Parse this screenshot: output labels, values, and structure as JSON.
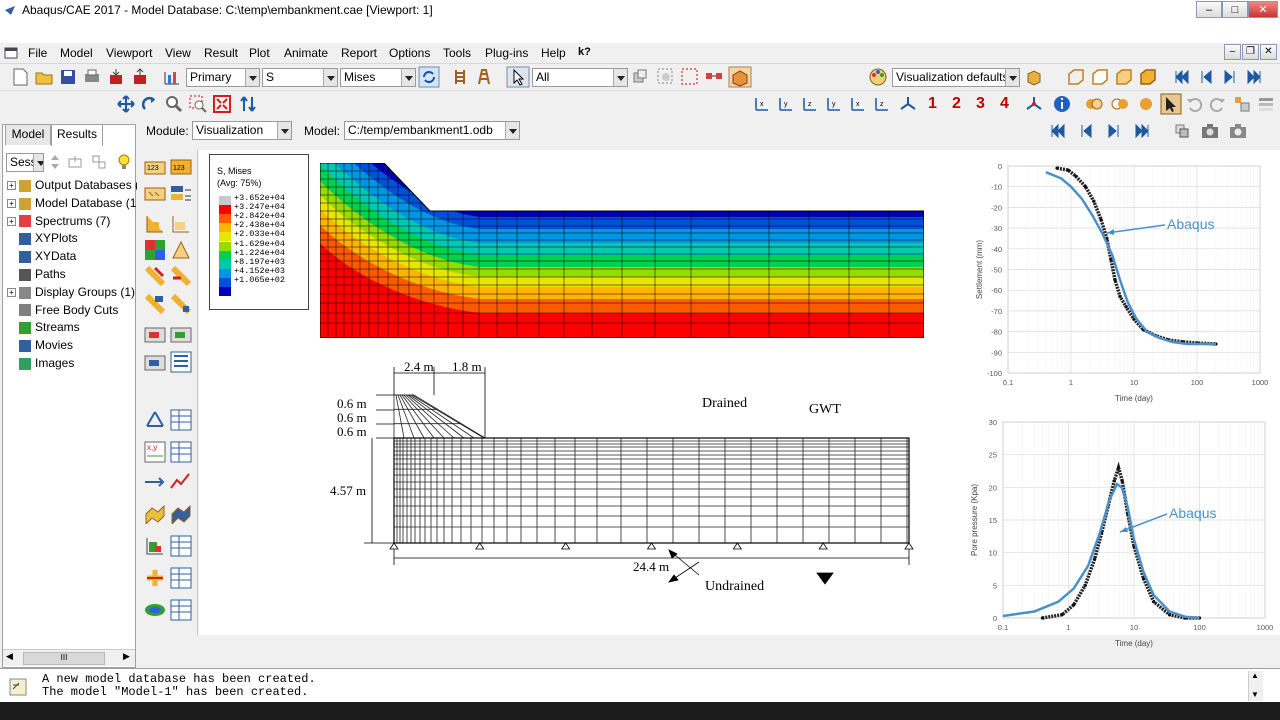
{
  "window": {
    "title": "Abaqus/CAE 2017 - Model Database: C:\\temp\\embankment.cae [Viewport: 1]",
    "min": "–",
    "max": "□",
    "close": "✕",
    "sub_min": "–",
    "sub_restore": "❐",
    "sub_close": "✕"
  },
  "menu": {
    "items": [
      "File",
      "Model",
      "Viewport",
      "View",
      "Result",
      "Plot",
      "Animate",
      "Report",
      "Options",
      "Tools",
      "Plug-ins",
      "Help",
      "k?"
    ]
  },
  "toolbar1": {
    "primary": "Primary",
    "variable": "S",
    "invariant": "Mises",
    "selection": "All",
    "vis_defaults": "Visualization defaults"
  },
  "toolbar2": {
    "numbers": [
      "1",
      "2",
      "3",
      "4"
    ]
  },
  "context": {
    "module_label": "Module:",
    "module_value": "Visualization",
    "model_label": "Model:",
    "model_value": "C:/temp/embankment1.odb"
  },
  "tree": {
    "tabs": [
      "Model",
      "Results"
    ],
    "session_value": "Sessi",
    "items": [
      {
        "label": "Output Databases (",
        "expand": "+"
      },
      {
        "label": "Model Database (1",
        "expand": "+"
      },
      {
        "label": "Spectrums (7)",
        "expand": "+"
      },
      {
        "label": "XYPlots",
        "expand": ""
      },
      {
        "label": "XYData",
        "expand": ""
      },
      {
        "label": "Paths",
        "expand": ""
      },
      {
        "label": "Display Groups (1)",
        "expand": "+"
      },
      {
        "label": "Free Body Cuts",
        "expand": ""
      },
      {
        "label": "Streams",
        "expand": ""
      },
      {
        "label": "Movies",
        "expand": ""
      },
      {
        "label": "Images",
        "expand": ""
      }
    ],
    "hscroll_mid": "III"
  },
  "legend": {
    "title1": "S, Mises",
    "title2": "(Avg: 75%)",
    "values": [
      "+3.652e+04",
      "+3.247e+04",
      "+2.842e+04",
      "+2.438e+04",
      "+2.033e+04",
      "+1.629e+04",
      "+1.224e+04",
      "+8.197e+03",
      "+4.152e+03",
      "+1.065e+02"
    ],
    "colors": [
      "#c8c8c8",
      "#ff0000",
      "#ff5a00",
      "#ffb400",
      "#e6e600",
      "#96dc00",
      "#00d250",
      "#00c8b4",
      "#0096e6",
      "#0050dc",
      "#0000b4"
    ]
  },
  "diagram": {
    "dim_24": "2.4 m",
    "dim_18": "1.8 m",
    "dim_06a": "0.6 m",
    "dim_06b": "0.6 m",
    "dim_06c": "0.6 m",
    "dim_457": "4.57 m",
    "dim_244": "24.4 m",
    "drained": "Drained",
    "gwt": "GWT",
    "undrained": "Undrained"
  },
  "chart_data": [
    {
      "type": "line",
      "ylabel": "Settlement (mm)",
      "xlabel": "Time (day)",
      "xscale": "log",
      "xlim": [
        0.1,
        1000
      ],
      "ylim": [
        -100,
        0
      ],
      "xticks": [
        "0.1",
        "1",
        "10",
        "100",
        "1000"
      ],
      "yticks": [
        "0",
        "-10",
        "-20",
        "-30",
        "-40",
        "-50",
        "-60",
        "-70",
        "-80",
        "-90",
        "-100"
      ],
      "annotation": "Abaqus",
      "color": "#4a90c8",
      "series": [
        {
          "values": [
            [
              0.4,
              -3
            ],
            [
              0.7,
              -6
            ],
            [
              1,
              -10
            ],
            [
              1.5,
              -16
            ],
            [
              2.2,
              -24
            ],
            [
              3.2,
              -33
            ],
            [
              4.5,
              -43
            ],
            [
              6,
              -55
            ],
            [
              8,
              -66
            ],
            [
              11,
              -74
            ],
            [
              16,
              -80
            ],
            [
              25,
              -83
            ],
            [
              40,
              -85
            ],
            [
              70,
              -86
            ],
            [
              120,
              -86
            ],
            [
              200,
              -86
            ]
          ]
        },
        {
          "values": [
            [
              0.6,
              -1
            ],
            [
              0.9,
              -2
            ],
            [
              1.2,
              -5
            ],
            [
              1.7,
              -10
            ],
            [
              2.3,
              -17
            ],
            [
              3,
              -26
            ],
            [
              3.7,
              -35
            ],
            [
              4.3,
              -45
            ],
            [
              5,
              -55
            ],
            [
              6,
              -63
            ],
            [
              7.5,
              -68
            ],
            [
              10,
              -74
            ],
            [
              14,
              -79
            ],
            [
              22,
              -82
            ],
            [
              35,
              -84
            ],
            [
              60,
              -85
            ],
            [
              100,
              -85.5
            ],
            [
              200,
              -86
            ]
          ]
        }
      ]
    },
    {
      "type": "line",
      "ylabel": "Pore pressure (Kpa)",
      "xlabel": "Time (day)",
      "xscale": "log",
      "xlim": [
        0.1,
        1000
      ],
      "ylim": [
        0,
        30
      ],
      "xticks": [
        "0.1",
        "1",
        "10",
        "100",
        "1000"
      ],
      "yticks": [
        "30",
        "25",
        "20",
        "15",
        "10",
        "5",
        "0"
      ],
      "annotation": "Abaqus",
      "color": "#4a90c8",
      "series": [
        {
          "values": [
            [
              0.1,
              0.3
            ],
            [
              0.3,
              1
            ],
            [
              0.7,
              2.5
            ],
            [
              1.2,
              4.5
            ],
            [
              2,
              8
            ],
            [
              3,
              13
            ],
            [
              4.2,
              18
            ],
            [
              5.5,
              20.5
            ],
            [
              6.5,
              20
            ],
            [
              8,
              17
            ],
            [
              10,
              12
            ],
            [
              14,
              7
            ],
            [
              20,
              3.5
            ],
            [
              35,
              1
            ],
            [
              60,
              0.2
            ],
            [
              100,
              0
            ]
          ]
        },
        {
          "values": [
            [
              0.4,
              0
            ],
            [
              0.8,
              0.5
            ],
            [
              1.2,
              2
            ],
            [
              1.8,
              5
            ],
            [
              2.5,
              9
            ],
            [
              3.2,
              13
            ],
            [
              4,
              17
            ],
            [
              5,
              21
            ],
            [
              5.8,
              23
            ],
            [
              6.6,
              21
            ],
            [
              8,
              16
            ],
            [
              10,
              11
            ],
            [
              14,
              6
            ],
            [
              20,
              2.5
            ],
            [
              35,
              0.5
            ],
            [
              60,
              0
            ],
            [
              100,
              0
            ]
          ]
        }
      ]
    }
  ],
  "messages": [
    "A new model database has been created.",
    "The model \"Model-1\" has been created."
  ]
}
